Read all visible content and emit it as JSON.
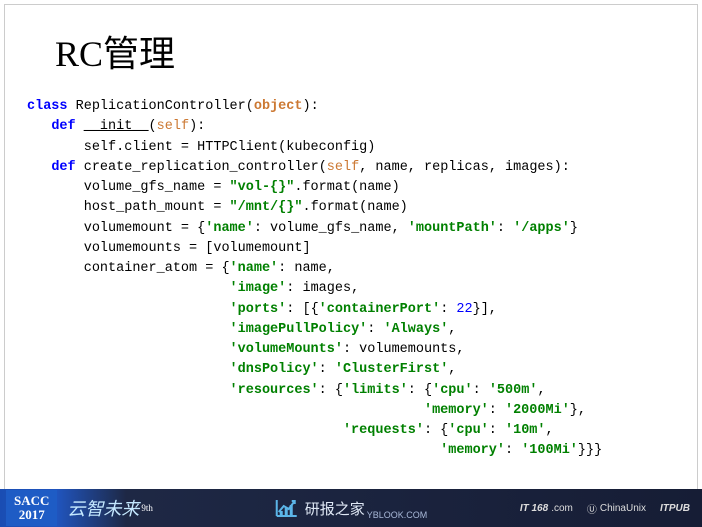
{
  "title": "RC管理",
  "code": {
    "class_kw": "class",
    "class_name": "ReplicationController",
    "object_kw": "object",
    "def_kw": "def",
    "init_name": "__init__",
    "self_kw": "self",
    "init_body": "self.client = HTTPClient(kubeconfig)",
    "create_func": "create_replication_controller",
    "create_params": ", name, replicas, images",
    "line1_a": "volume_gfs_name = ",
    "line1_str": "\"vol-{}\"",
    "line1_b": ".format(name)",
    "line2_a": "host_path_mount = ",
    "line2_str": "\"/mnt/{}\"",
    "line2_b": ".format(name)",
    "line3_a": "volumemount = {",
    "line3_k1": "'name'",
    "line3_v1": ": volume_gfs_name, ",
    "line3_k2": "'mountPath'",
    "line3_c": ": ",
    "line3_v2": "'/apps'",
    "line3_e": "}",
    "line4": "volumemounts = [volumemount]",
    "line5_a": "container_atom = {",
    "line5_k": "'name'",
    "line5_v": ": name,",
    "line6_k": "'image'",
    "line6_v": ": images,",
    "line7_k": "'ports'",
    "line7_a": ": [{",
    "line7_k2": "'containerPort'",
    "line7_b": ": ",
    "line7_num": "22",
    "line7_c": "}],",
    "line8_k": "'imagePullPolicy'",
    "line8_c": ": ",
    "line8_v": "'Always'",
    "line8_e": ",",
    "line9_k": "'volumeMounts'",
    "line9_v": ": volumemounts,",
    "line10_k": "'dnsPolicy'",
    "line10_c": ": ",
    "line10_v": "'ClusterFirst'",
    "line10_e": ",",
    "line11_k": "'resources'",
    "line11_a": ": {",
    "line11_k2": "'limits'",
    "line11_b": ": {",
    "line11_k3": "'cpu'",
    "line11_c": ": ",
    "line11_v3": "'500m'",
    "line11_d": ",",
    "line12_k": "'memory'",
    "line12_c": ": ",
    "line12_v": "'2000Mi'",
    "line12_e": "},",
    "line13_k": "'requests'",
    "line13_a": ": {",
    "line13_k2": "'cpu'",
    "line13_b": ": ",
    "line13_v2": "'10m'",
    "line13_c": ",",
    "line14_k": "'memory'",
    "line14_c": ": ",
    "line14_v": "'100Mi'",
    "line14_e": "}}}"
  },
  "footer": {
    "sacc": "SACC",
    "year": "2017",
    "chinese": "云智未来",
    "th": "9th",
    "center_text": "研报之家",
    "center_sub": "YBLOOK.COM",
    "it168": "IT 168",
    "it168_suffix": ".com",
    "chinaunix": "ChinaUnix",
    "itpub": "ITPUB"
  }
}
